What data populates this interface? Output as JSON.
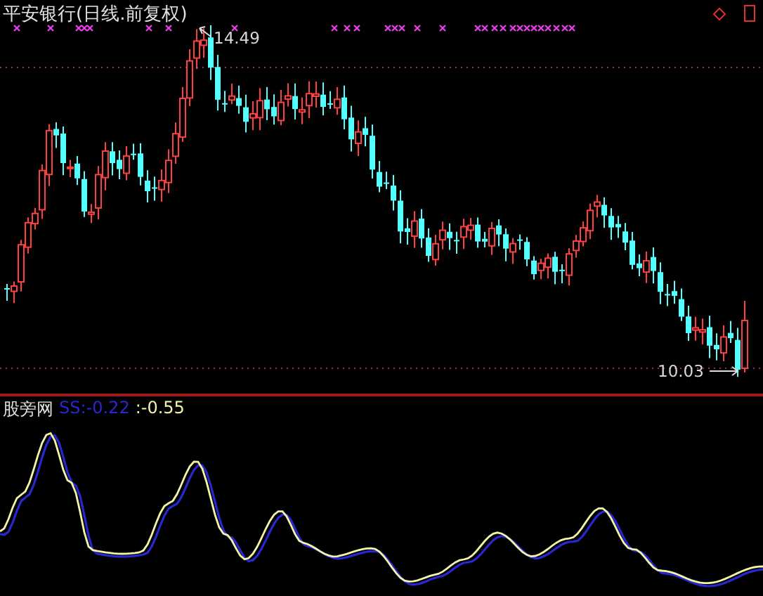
{
  "title": "平安银行(日线.前复权)",
  "high_label": "14.49",
  "low_label": "10.03",
  "indicator": {
    "name": "股旁网",
    "values": [
      {
        "text": "SS:-0.22",
        "color": "#2828d0"
      },
      {
        "text": ":-0.55",
        "color": "#f4f4a8"
      }
    ]
  }
}
